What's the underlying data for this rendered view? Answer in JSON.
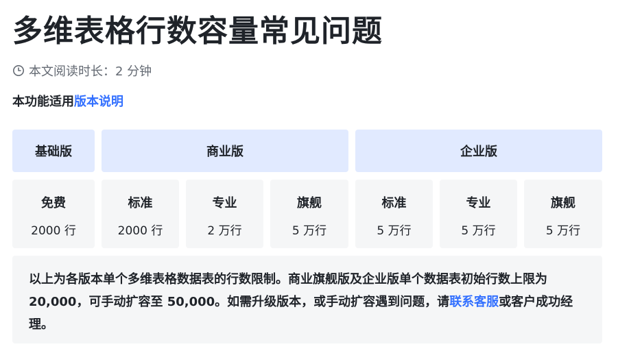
{
  "page_title": "多维表格行数容量常见问题",
  "meta": {
    "read_time": "本文阅读时长：2 分钟"
  },
  "applicability": {
    "prefix": "本功能适用",
    "link_text": "版本说明"
  },
  "edition_groups": [
    {
      "label": "基础版"
    },
    {
      "label": "商业版"
    },
    {
      "label": "企业版"
    }
  ],
  "plans": [
    {
      "name": "免费",
      "limit": "2000 行"
    },
    {
      "name": "标准",
      "limit": "2000 行"
    },
    {
      "name": "专业",
      "limit": "2 万行"
    },
    {
      "name": "旗舰",
      "limit": "5 万行"
    },
    {
      "name": "标准",
      "limit": "5 万行"
    },
    {
      "name": "专业",
      "limit": "5 万行"
    },
    {
      "name": "旗舰",
      "limit": "5 万行"
    }
  ],
  "note": {
    "text_before_link": "以上为各版本单个多维表格数据表的行数限制。商业旗舰版及企业版单个数据表初始行数上限为 20,000，可手动扩容至 50,000。如需升级版本，或手动扩容遇到问题，请",
    "link_text": "联系客服",
    "text_after_link": "或客户成功经理。"
  },
  "colors": {
    "accent_link": "#3370ff",
    "header_bg": "#e1eaff",
    "cell_bg": "#f5f6f7",
    "text_primary": "#1f2329",
    "text_secondary": "#646a73"
  },
  "icons": {
    "read_time": "clock-icon"
  }
}
